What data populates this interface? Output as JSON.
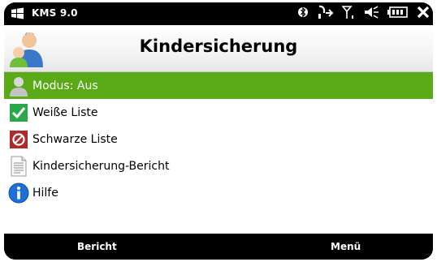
{
  "status_bar": {
    "app_title": "KMS 9.0",
    "icons": [
      "bluetooth-icon",
      "network-sync-icon",
      "signal-icon",
      "volume-icon",
      "battery-icon",
      "close-icon"
    ]
  },
  "header": {
    "title": "Kindersicherung",
    "icon": "parent-child-avatar-icon"
  },
  "menu": {
    "items": [
      {
        "label": "Modus: Aus",
        "icon": "person-grey-icon",
        "selected": true
      },
      {
        "label": "Weiße Liste",
        "icon": "checkmark-icon",
        "selected": false
      },
      {
        "label": "Schwarze Liste",
        "icon": "blocked-icon",
        "selected": false
      },
      {
        "label": "Kindersicherung-Bericht",
        "icon": "report-document-icon",
        "selected": false
      },
      {
        "label": "Hilfe",
        "icon": "info-icon",
        "selected": false
      }
    ]
  },
  "softkeys": {
    "left": "Bericht",
    "right": "Menü"
  },
  "colors": {
    "selection": "#5aa916",
    "check_green": "#2aa84a",
    "blocked_red": "#b02a2a",
    "info_blue": "#1f6fd8"
  }
}
